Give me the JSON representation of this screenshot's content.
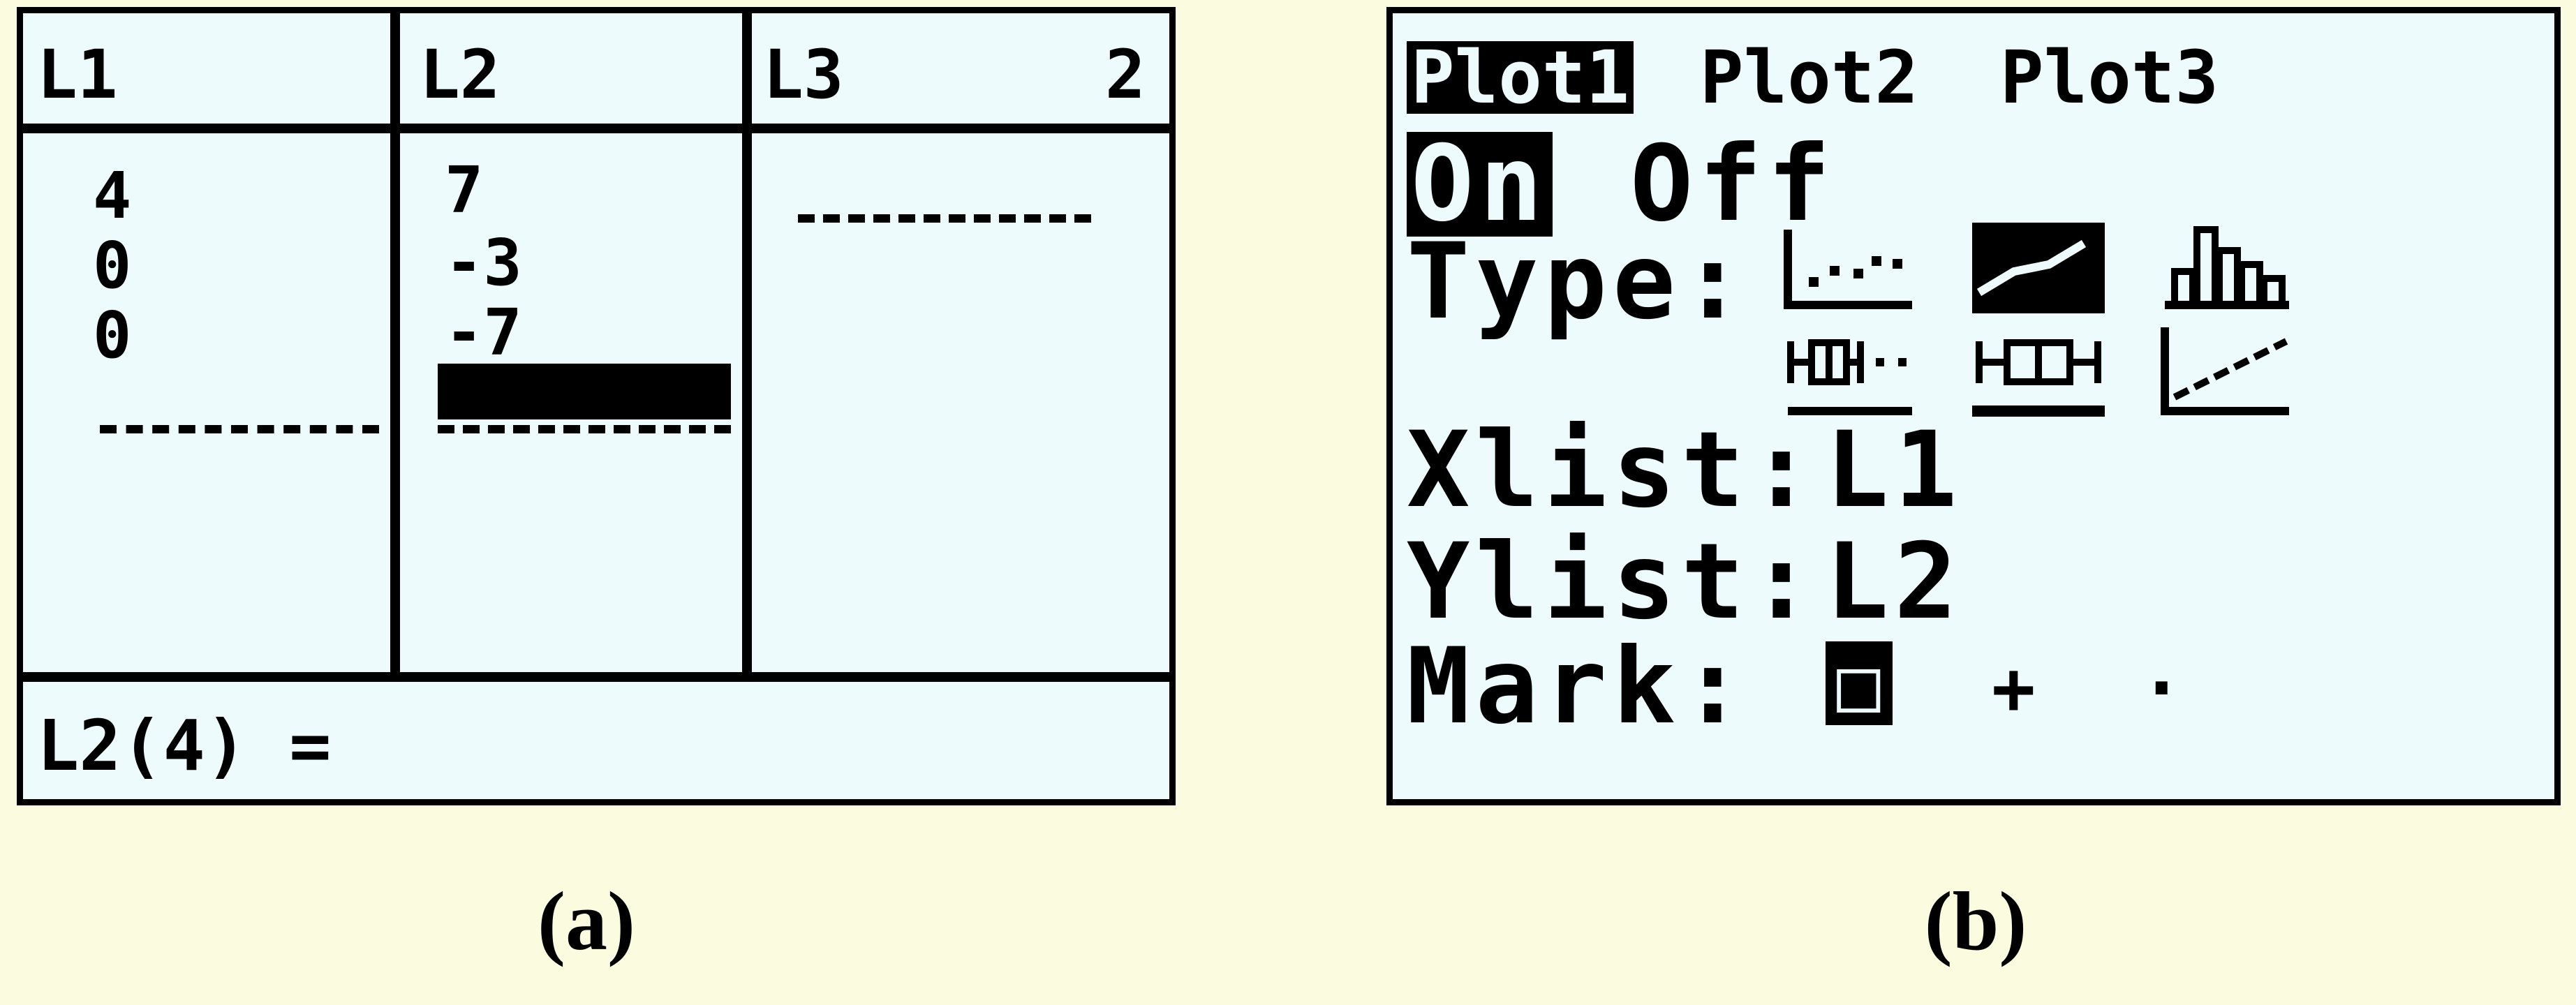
{
  "panel_a": {
    "headers": [
      "L1",
      "L2",
      "L3"
    ],
    "column_number": "2",
    "columns": {
      "L1": [
        "4",
        "0",
        "0"
      ],
      "L2": [
        "7",
        "-3",
        "-7"
      ],
      "L3": []
    },
    "entry_line": "L2(4) ="
  },
  "panel_b": {
    "plots": [
      "Plot1",
      "Plot2",
      "Plot3"
    ],
    "on_label": "On",
    "off_label": "Off",
    "type_label": "Type:",
    "type_icons": [
      "scatter-plot-icon",
      "xyline-plot-icon",
      "histogram-icon",
      "modified-boxplot-icon",
      "boxplot-icon",
      "normal-probability-icon"
    ],
    "xlist_label": "Xlist:",
    "xlist_value": "L1",
    "ylist_label": "Ylist:",
    "ylist_value": "L2",
    "mark_label": "Mark:",
    "marks": [
      "□",
      "+",
      "·"
    ]
  },
  "captions": [
    "(a)",
    "(b)"
  ]
}
